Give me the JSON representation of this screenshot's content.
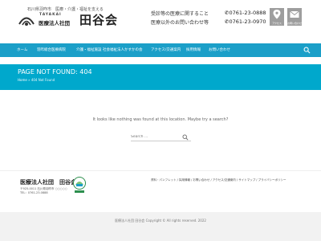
{
  "header": {
    "tagline": "石川県羽咋市　医療・介護・福祉を支える",
    "romaji": "TAYAKAI",
    "corp": "医療法人社団",
    "name": "田谷会",
    "contact": [
      {
        "label": "受診等の医療に関すること",
        "phone": "0761-23-0888"
      },
      {
        "label": "医療以外のお問い合わせ等",
        "phone": "0761-23-0970"
      }
    ],
    "buttons": {
      "access": "アクセス",
      "contact": "お問い合わせ"
    }
  },
  "nav": {
    "items": [
      "ホーム",
      "羽咋総合医療病院",
      "介護・福祉施設",
      "社会福祉法人かすかの会",
      "アクセス/交通案内",
      "採用情報",
      "お問い合わせ"
    ]
  },
  "banner": {
    "title": "PAGE NOT FOUND: 404",
    "breadcrumb_home": "Home",
    "breadcrumb_sep": "»",
    "breadcrumb_current": "404 Not Found"
  },
  "content": {
    "message": "It looks like nothing was found at this location. Maybe try a search?",
    "search_placeholder": "Search ..."
  },
  "footer": {
    "name": "医療法人社団　田谷会",
    "address": "〒925-0011 石川県羽咋市 ○○○○○",
    "tel": "TEL：0761-23-0888",
    "links": "資料・パンフレット / 採用情報 / お問い合わせ / アクセス/交通案内 / サイトマップ / プライバシーポリシー",
    "copyright": "医療法人社団 田谷会 Copyright © All rights reserved. 2022"
  },
  "colors": {
    "nav_bg": "#1b9fc8",
    "banner_bg": "#00a8cc",
    "header_button_bg": "#9e9e9e",
    "footer_bottom_bg": "#f2f2f2"
  }
}
